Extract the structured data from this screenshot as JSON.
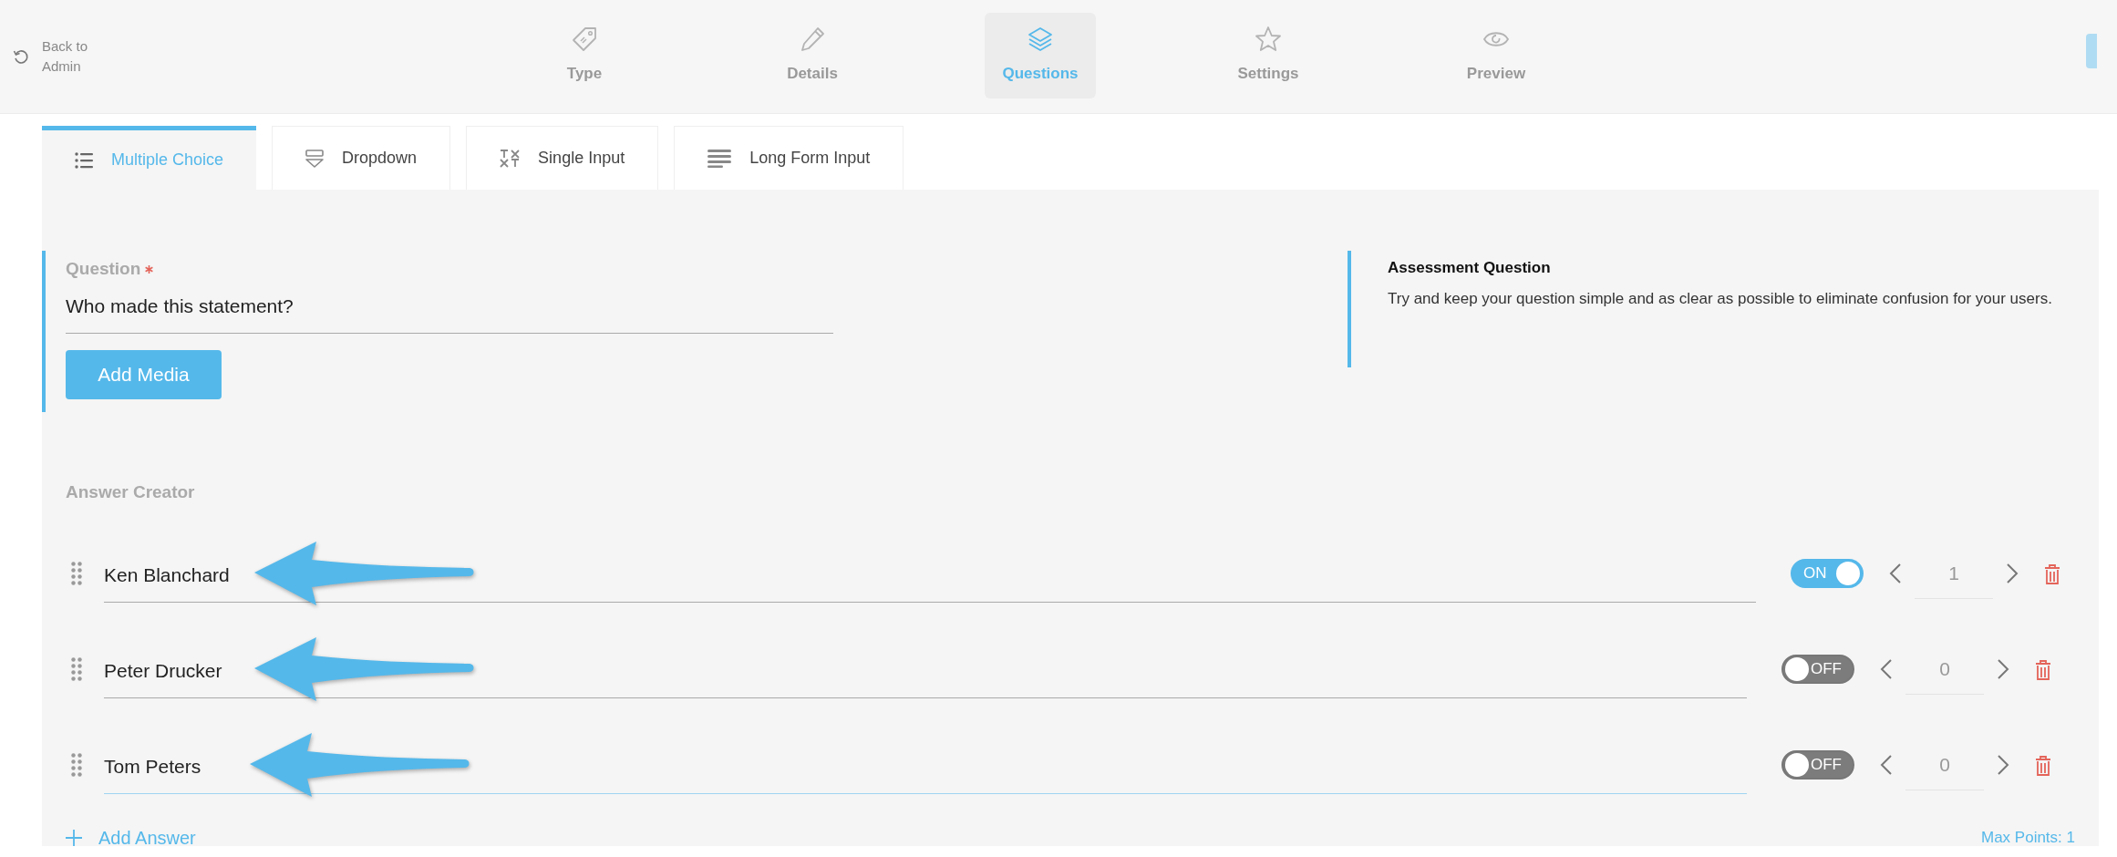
{
  "back_link": {
    "label": "Back to Admin"
  },
  "steps": [
    {
      "label": "Type",
      "selected": false
    },
    {
      "label": "Details",
      "selected": false
    },
    {
      "label": "Questions",
      "selected": true
    },
    {
      "label": "Settings",
      "selected": false
    },
    {
      "label": "Preview",
      "selected": false
    }
  ],
  "question_types": [
    {
      "label": "Multiple Choice",
      "selected": true
    },
    {
      "label": "Dropdown",
      "selected": false
    },
    {
      "label": "Single Input",
      "selected": false
    },
    {
      "label": "Long Form Input",
      "selected": false
    }
  ],
  "question": {
    "label": "Question",
    "required": true,
    "value": "Who made this statement?"
  },
  "add_media_button": "Add Media",
  "help": {
    "title": "Assessment Question",
    "text": "Try and keep your question simple and as clear as possible to eliminate confusion for your users."
  },
  "answer_creator": {
    "label": "Answer Creator",
    "answers": [
      {
        "text": "Ken Blanchard",
        "correct": true,
        "toggle_label": "ON",
        "points": "1",
        "focused": false,
        "pointer_arrow": true
      },
      {
        "text": "Peter Drucker",
        "correct": false,
        "toggle_label": "OFF",
        "points": "0",
        "focused": false,
        "pointer_arrow": true
      },
      {
        "text": "Tom Peters",
        "correct": false,
        "toggle_label": "OFF",
        "points": "0",
        "focused": true,
        "pointer_arrow": true
      }
    ],
    "add_answer": "Add Answer",
    "max_points": "Max Points: 1"
  }
}
